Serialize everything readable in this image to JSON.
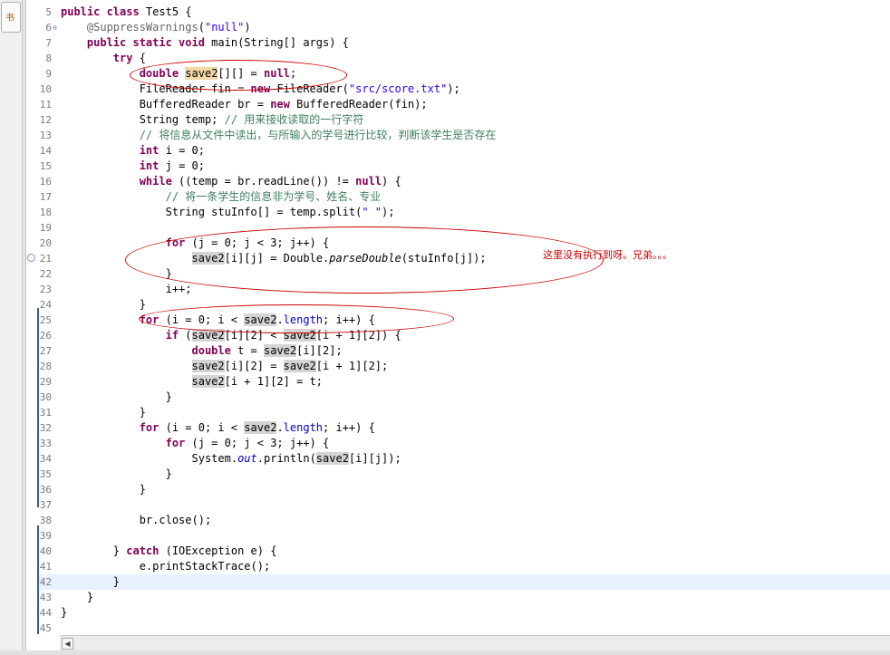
{
  "side_tab": {
    "label": "书"
  },
  "editor": {
    "note": "这里没有执行到呀。兄弟。。。",
    "lines": [
      {
        "n": "5",
        "segs": [
          {
            "t": "public class",
            "k": "kw"
          },
          {
            "t": " Test5 {"
          }
        ]
      },
      {
        "n": "6",
        "fold": "⊖",
        "segs": [
          {
            "t": "    "
          },
          {
            "t": "@SuppressWarnings",
            "k": "ann"
          },
          {
            "t": "("
          },
          {
            "t": "\"null\"",
            "k": "str"
          },
          {
            "t": ")"
          }
        ]
      },
      {
        "n": "7",
        "segs": [
          {
            "t": "    "
          },
          {
            "t": "public static void",
            "k": "kw"
          },
          {
            "t": " main(String[] args) {"
          }
        ]
      },
      {
        "n": "8",
        "segs": [
          {
            "t": "        "
          },
          {
            "t": "try",
            "k": "kw"
          },
          {
            "t": " {"
          }
        ]
      },
      {
        "n": "9",
        "segs": [
          {
            "t": "            "
          },
          {
            "t": "double",
            "k": "kw"
          },
          {
            "t": " "
          },
          {
            "t": "save2",
            "k": "hl-write"
          },
          {
            "t": "[][] = "
          },
          {
            "t": "null",
            "k": "kw"
          },
          {
            "t": ";"
          }
        ]
      },
      {
        "n": "10",
        "segs": [
          {
            "t": "            FileReader fin = "
          },
          {
            "t": "new",
            "k": "kw"
          },
          {
            "t": " FileReader("
          },
          {
            "t": "\"src/score.txt\"",
            "k": "str"
          },
          {
            "t": ");"
          }
        ]
      },
      {
        "n": "11",
        "segs": [
          {
            "t": "            BufferedReader br = "
          },
          {
            "t": "new",
            "k": "kw"
          },
          {
            "t": " BufferedReader(fin);"
          }
        ]
      },
      {
        "n": "12",
        "segs": [
          {
            "t": "            String temp; "
          },
          {
            "t": "// 用来接收读取的一行字符",
            "k": "cmt"
          }
        ]
      },
      {
        "n": "13",
        "segs": [
          {
            "t": "            "
          },
          {
            "t": "// 将信息从文件中读出，与所输入的学号进行比较，判断该学生是否存在",
            "k": "cmt"
          }
        ]
      },
      {
        "n": "14",
        "segs": [
          {
            "t": "            "
          },
          {
            "t": "int",
            "k": "kw"
          },
          {
            "t": " i = 0;"
          }
        ]
      },
      {
        "n": "15",
        "segs": [
          {
            "t": "            "
          },
          {
            "t": "int",
            "k": "kw"
          },
          {
            "t": " j = 0;"
          }
        ]
      },
      {
        "n": "16",
        "segs": [
          {
            "t": "            "
          },
          {
            "t": "while",
            "k": "kw"
          },
          {
            "t": " ((temp = br.readLine()) != "
          },
          {
            "t": "null",
            "k": "kw"
          },
          {
            "t": ") {"
          }
        ]
      },
      {
        "n": "17",
        "segs": [
          {
            "t": "                "
          },
          {
            "t": "// 将一条学生的信息非为学号、姓名、专业",
            "k": "cmt"
          }
        ]
      },
      {
        "n": "18",
        "segs": [
          {
            "t": "                String stuInfo[] = temp.split("
          },
          {
            "t": "\" \"",
            "k": "str"
          },
          {
            "t": ");"
          }
        ]
      },
      {
        "n": "19",
        "segs": []
      },
      {
        "n": "20",
        "segs": [
          {
            "t": "                "
          },
          {
            "t": "for",
            "k": "kw"
          },
          {
            "t": " (j = 0; j < 3; j++) {"
          }
        ]
      },
      {
        "n": "21",
        "segs": [
          {
            "t": "                    "
          },
          {
            "t": "save2",
            "k": "hl-read"
          },
          {
            "t": "[i][j] = Double."
          },
          {
            "t": "parseDouble",
            "k": "italic"
          },
          {
            "t": "(stuInfo[j]);"
          }
        ]
      },
      {
        "n": "22",
        "segs": [
          {
            "t": "                }"
          }
        ]
      },
      {
        "n": "23",
        "segs": [
          {
            "t": "                i++;"
          }
        ]
      },
      {
        "n": "24",
        "segs": [
          {
            "t": "            }"
          }
        ]
      },
      {
        "n": "25",
        "segs": [
          {
            "t": "            "
          },
          {
            "t": "for",
            "k": "kw"
          },
          {
            "t": " (i = 0; i < "
          },
          {
            "t": "save2",
            "k": "hl-read"
          },
          {
            "t": "."
          },
          {
            "t": "length",
            "k": "fld"
          },
          {
            "t": "; i++) {"
          }
        ]
      },
      {
        "n": "26",
        "segs": [
          {
            "t": "                "
          },
          {
            "t": "if",
            "k": "kw"
          },
          {
            "t": " ("
          },
          {
            "t": "save2",
            "k": "hl-read"
          },
          {
            "t": "[i][2] < "
          },
          {
            "t": "save2",
            "k": "hl-read"
          },
          {
            "t": "[i + 1][2]) {"
          }
        ]
      },
      {
        "n": "27",
        "segs": [
          {
            "t": "                    "
          },
          {
            "t": "double",
            "k": "kw"
          },
          {
            "t": " t = "
          },
          {
            "t": "save2",
            "k": "hl-read"
          },
          {
            "t": "[i][2];"
          }
        ]
      },
      {
        "n": "28",
        "segs": [
          {
            "t": "                    "
          },
          {
            "t": "save2",
            "k": "hl-read"
          },
          {
            "t": "[i][2] = "
          },
          {
            "t": "save2",
            "k": "hl-read"
          },
          {
            "t": "[i + 1][2];"
          }
        ]
      },
      {
        "n": "29",
        "segs": [
          {
            "t": "                    "
          },
          {
            "t": "save2",
            "k": "hl-read"
          },
          {
            "t": "[i + 1][2] = t;"
          }
        ]
      },
      {
        "n": "30",
        "segs": [
          {
            "t": "                }"
          }
        ]
      },
      {
        "n": "31",
        "segs": [
          {
            "t": "            }"
          }
        ]
      },
      {
        "n": "32",
        "segs": [
          {
            "t": "            "
          },
          {
            "t": "for",
            "k": "kw"
          },
          {
            "t": " (i = 0; i < "
          },
          {
            "t": "save2",
            "k": "hl-read"
          },
          {
            "t": "."
          },
          {
            "t": "length",
            "k": "fld"
          },
          {
            "t": "; i++) {"
          }
        ]
      },
      {
        "n": "33",
        "segs": [
          {
            "t": "                "
          },
          {
            "t": "for",
            "k": "kw"
          },
          {
            "t": " (j = 0; j < 3; j++) {"
          }
        ]
      },
      {
        "n": "34",
        "segs": [
          {
            "t": "                    System."
          },
          {
            "t": "out",
            "k": "field"
          },
          {
            "t": ".println("
          },
          {
            "t": "save2",
            "k": "hl-read"
          },
          {
            "t": "[i][j]);"
          }
        ]
      },
      {
        "n": "35",
        "segs": [
          {
            "t": "                }"
          }
        ]
      },
      {
        "n": "36",
        "segs": [
          {
            "t": "            }"
          }
        ]
      },
      {
        "n": "37",
        "segs": []
      },
      {
        "n": "38",
        "segs": [
          {
            "t": "            br.close();"
          }
        ]
      },
      {
        "n": "39",
        "segs": []
      },
      {
        "n": "40",
        "segs": [
          {
            "t": "        } "
          },
          {
            "t": "catch",
            "k": "kw"
          },
          {
            "t": " (IOException e) {"
          }
        ]
      },
      {
        "n": "41",
        "segs": [
          {
            "t": "            e.printStackTrace();"
          }
        ]
      },
      {
        "n": "42",
        "current": true,
        "segs": [
          {
            "t": "        }"
          }
        ]
      },
      {
        "n": "43",
        "segs": [
          {
            "t": "    }"
          }
        ]
      },
      {
        "n": "44",
        "segs": [
          {
            "t": "}"
          }
        ]
      },
      {
        "n": "45",
        "segs": []
      }
    ]
  },
  "scrollbar": {
    "left_arrow": "◀"
  }
}
